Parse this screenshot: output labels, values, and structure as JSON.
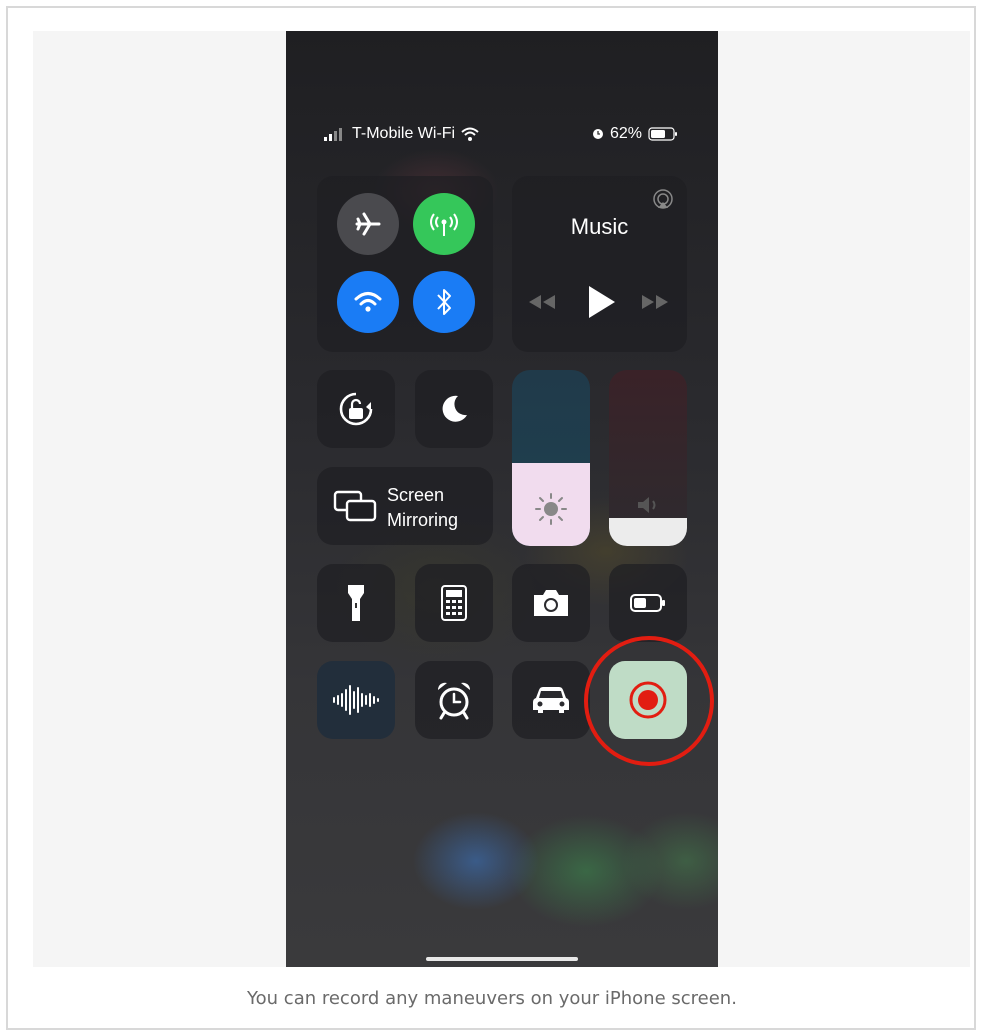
{
  "status_bar": {
    "carrier": "T-Mobile Wi-Fi",
    "battery_percent": "62%"
  },
  "connectivity": {
    "airplane": {
      "icon": "airplane-icon",
      "active": false
    },
    "cellular": {
      "icon": "cellular-antenna-icon",
      "active": true,
      "color": "#35c75a"
    },
    "wifi": {
      "icon": "wifi-icon",
      "active": true,
      "color": "#1a7cf5"
    },
    "bluetooth": {
      "icon": "bluetooth-icon",
      "active": true,
      "color": "#1a7cf5"
    }
  },
  "music": {
    "title": "Music",
    "controls": [
      "rewind-icon",
      "play-icon",
      "fast-forward-icon"
    ]
  },
  "screen_mirroring": {
    "line1": "Screen",
    "line2": "Mirroring"
  },
  "brightness": {
    "level": 0.47
  },
  "volume": {
    "level": 0.16
  },
  "controls": [
    {
      "name": "flashlight",
      "icon": "flashlight-icon"
    },
    {
      "name": "calculator",
      "icon": "calculator-icon"
    },
    {
      "name": "camera",
      "icon": "camera-icon"
    },
    {
      "name": "low-power-mode",
      "icon": "battery-icon"
    },
    {
      "name": "voice-memos",
      "icon": "waveform-icon"
    },
    {
      "name": "alarm",
      "icon": "alarm-clock-icon"
    },
    {
      "name": "do-not-disturb-while-driving",
      "icon": "car-icon"
    },
    {
      "name": "screen-recording",
      "icon": "record-icon",
      "highlighted": true
    }
  ],
  "colors": {
    "accent_red": "#e21d11",
    "record_tile": "#bfdcc6"
  },
  "caption": "You can record any maneuvers on your iPhone screen."
}
